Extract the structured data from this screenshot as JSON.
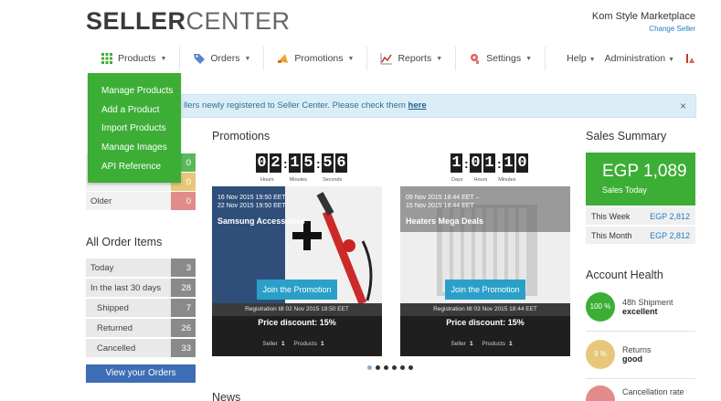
{
  "header": {
    "brand_bold": "SELLER",
    "brand_light": "CENTER",
    "store_name": "Kom Style Marketplace",
    "change_seller": "Change Seller"
  },
  "nav": {
    "items": [
      {
        "label": "Products",
        "icon": "grid-icon"
      },
      {
        "label": "Orders",
        "icon": "tag-icon"
      },
      {
        "label": "Promotions",
        "icon": "megaphone-icon"
      },
      {
        "label": "Reports",
        "icon": "chart-icon"
      },
      {
        "label": "Settings",
        "icon": "settings-icon"
      }
    ],
    "help": "Help",
    "administration": "Administration"
  },
  "dropdown": {
    "items": [
      "Manage Products",
      "Add a Product",
      "Import Products",
      "Manage Images",
      "API Reference"
    ]
  },
  "alert": {
    "text": "llers newly registered to Seller Center. Please check them",
    "link": "here",
    "close": "×"
  },
  "left": {
    "partial_rows": [
      {
        "value": "0",
        "color": "#5cb85c"
      },
      {
        "value": "0",
        "color": "#e8c77a"
      }
    ],
    "older": {
      "label": "Older",
      "value": "0",
      "color": "#e28b8b"
    },
    "orders_title": "All Order Items",
    "orders": [
      {
        "label": "Today",
        "value": "3"
      },
      {
        "label": "In the last 30 days",
        "value": "28"
      },
      {
        "label": "Shipped",
        "value": "7"
      },
      {
        "label": "Returned",
        "value": "26"
      },
      {
        "label": "Cancelled",
        "value": "33"
      }
    ],
    "view_button": "View your Orders"
  },
  "promotions": {
    "title": "Promotions",
    "timer1": {
      "digits": [
        "0",
        "2",
        "1",
        "5",
        "5",
        "6"
      ],
      "labels": [
        "Hours",
        "Minutes",
        "Seconds"
      ]
    },
    "timer2": {
      "digits": [
        "1",
        "0",
        "1",
        "1",
        "0"
      ],
      "labels": [
        "Days",
        "Hours",
        "Minutes"
      ]
    },
    "cards": [
      {
        "dates_line1": "16 Nov 2015 19:50 EET –",
        "dates_line2": "22 Nov 2015 19:50 EET",
        "title": "Samsung Accessories",
        "join": "Join the Promotion",
        "registration": "Registration till 02 Nov 2015 19:50 EET",
        "discount": "Price discount: 15%",
        "seller_label": "Seller",
        "seller_value": "1",
        "products_label": "Products",
        "products_value": "1"
      },
      {
        "dates_line1": "09 Nov 2015 18:44 EET –",
        "dates_line2": "15 Nov 2015 18:44 EET",
        "title": "Heaters Mega Deals",
        "join": "Join the Promotion",
        "registration": "Registration till 03 Nov 2015 18:44 EET",
        "discount": "Price discount: 15%",
        "seller_label": "Seller",
        "seller_value": "1",
        "products_label": "Products",
        "products_value": "1"
      }
    ],
    "news": "News"
  },
  "sales": {
    "title": "Sales Summary",
    "amount": "EGP 1,089",
    "amount_label": "Sales Today",
    "rows": [
      {
        "label": "This Week",
        "value": "EGP 2,812"
      },
      {
        "label": "This Month",
        "value": "EGP 2,812"
      }
    ]
  },
  "health": {
    "title": "Account Health",
    "items": [
      {
        "circle": "100 %",
        "label": "48h Shipment",
        "status": "excellent",
        "color": "#3cae35"
      },
      {
        "circle": "9 %",
        "label": "Returns",
        "status": "good",
        "color": "#e8c77a"
      },
      {
        "circle": "",
        "label": "Cancellation rate",
        "status": "",
        "color": "#e28b8b"
      }
    ]
  }
}
